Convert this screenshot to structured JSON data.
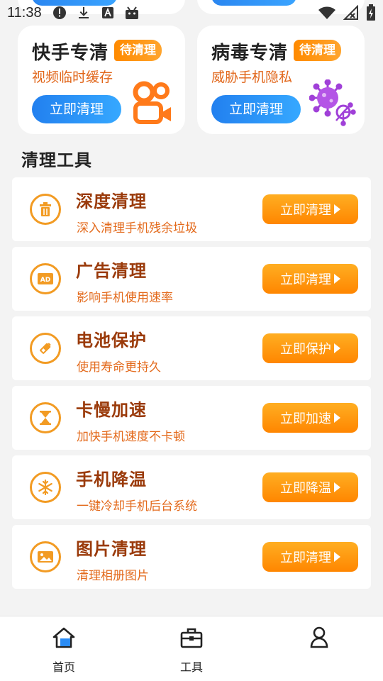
{
  "status_bar": {
    "time": "11:38",
    "icons": [
      "alert-icon",
      "download-icon",
      "font-icon",
      "android-icon",
      "wifi-icon",
      "no-signal-icon",
      "battery-charging-icon"
    ]
  },
  "feature_cards": [
    {
      "title": "快手专清",
      "tag": "待清理",
      "subtitle": "视频临时缓存",
      "button": "立即清理",
      "art": "kuaishou-camera-icon"
    },
    {
      "title": "病毒专清",
      "tag": "待清理",
      "subtitle": "威胁手机隐私",
      "button": "立即清理",
      "art": "virus-icon"
    }
  ],
  "section_title": "清理工具",
  "tools": [
    {
      "title": "深度清理",
      "subtitle": "深入清理手机残余垃圾",
      "button": "立即清理",
      "icon": "trash-icon"
    },
    {
      "title": "广告清理",
      "subtitle": "影响手机使用速率",
      "button": "立即清理",
      "icon": "ad-icon"
    },
    {
      "title": "电池保护",
      "subtitle": "使用寿命更持久",
      "button": "立即保护",
      "icon": "battery-icon"
    },
    {
      "title": "卡慢加速",
      "subtitle": "加快手机速度不卡顿",
      "button": "立即加速",
      "icon": "hourglass-icon"
    },
    {
      "title": "手机降温",
      "subtitle": "一键冷却手机后台系统",
      "button": "立即降温",
      "icon": "snowflake-icon"
    },
    {
      "title": "图片清理",
      "subtitle": "清理相册图片",
      "button": "立即清理",
      "icon": "image-icon"
    }
  ],
  "bottom_nav": [
    {
      "label": "首页",
      "icon": "home-icon",
      "active": true
    },
    {
      "label": "工具",
      "icon": "toolbox-icon",
      "active": false
    },
    {
      "label": "",
      "icon": "profile-icon",
      "active": false
    }
  ],
  "colors": {
    "accent_blue": "#2a8cf5",
    "accent_orange": "#ff9410",
    "title_brown": "#9a3a0a",
    "subtitle_orange": "#e36a1c"
  }
}
